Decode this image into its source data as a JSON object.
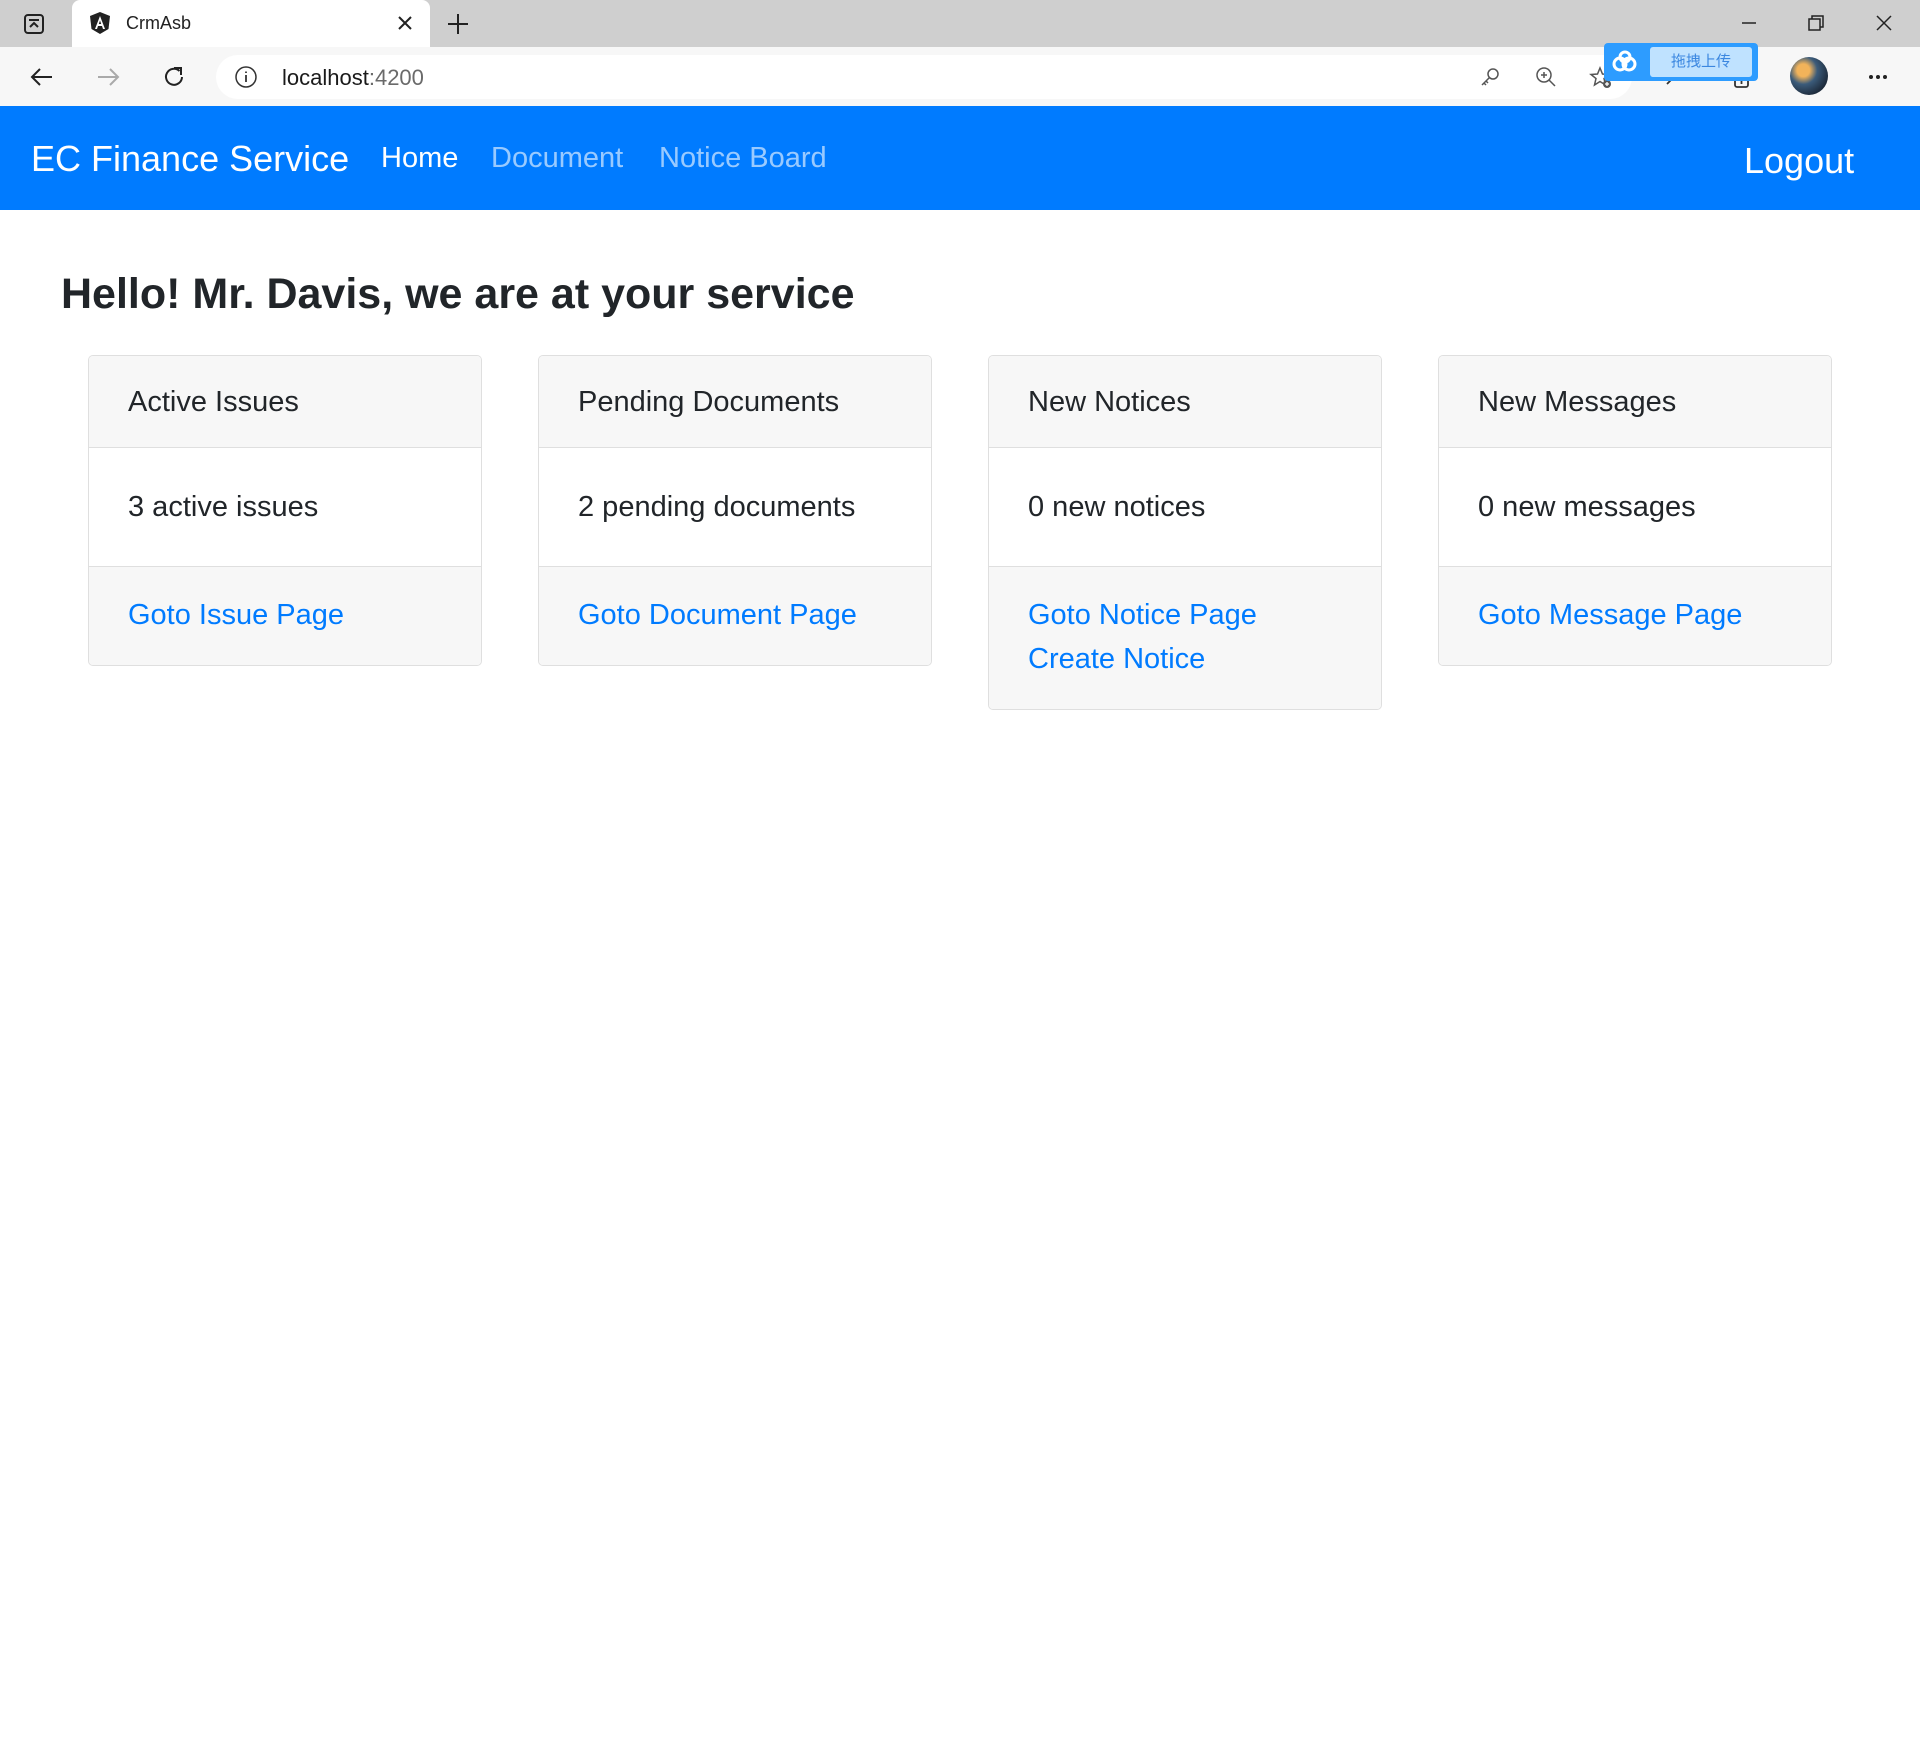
{
  "browser": {
    "tab_title": "CrmAsb",
    "url_host": "localhost",
    "url_port": ":4200",
    "extension_label": "拖拽上传"
  },
  "navbar": {
    "brand": "EC Finance Service",
    "links": [
      "Home",
      "Document",
      "Notice Board"
    ],
    "logout": "Logout"
  },
  "greeting": "Hello! Mr. Davis, we are at your service",
  "cards": [
    {
      "header": "Active Issues",
      "body": "3 active issues",
      "links": [
        "Goto Issue Page"
      ]
    },
    {
      "header": "Pending Documents",
      "body": "2 pending documents",
      "links": [
        "Goto Document Page"
      ]
    },
    {
      "header": "New Notices",
      "body": "0 new notices",
      "links": [
        "Goto Notice Page",
        "Create Notice"
      ]
    },
    {
      "header": "New Messages",
      "body": "0 new messages",
      "links": [
        "Goto Message Page"
      ]
    }
  ],
  "colors": {
    "primary": "#007bff",
    "card_bg": "#f7f7f7",
    "text": "#212529"
  }
}
